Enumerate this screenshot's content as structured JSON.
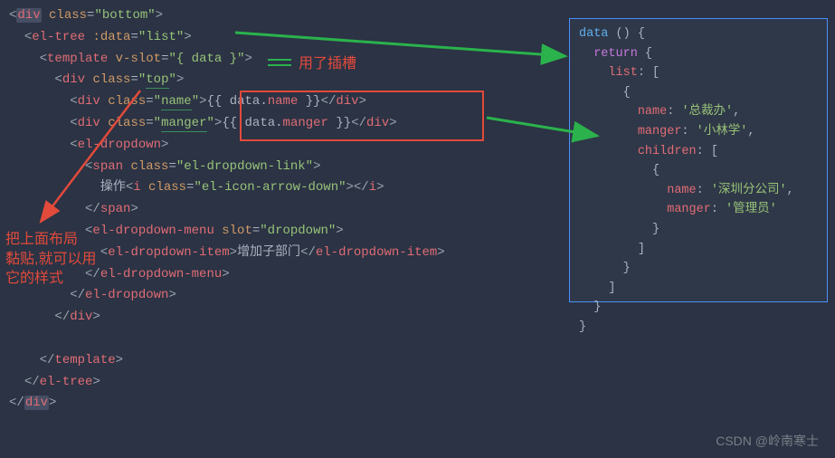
{
  "code": {
    "l1": {
      "tokens": [
        {
          "t": "<",
          "c": "tag-bracket"
        },
        {
          "t": "div",
          "c": "tag-name sel-box"
        },
        {
          "t": " ",
          "c": ""
        },
        {
          "t": "class",
          "c": "attr-name"
        },
        {
          "t": "=",
          "c": "attr-eq"
        },
        {
          "t": "\"bottom\"",
          "c": "attr-val"
        },
        {
          "t": ">",
          "c": "tag-bracket"
        }
      ],
      "indent": 0
    },
    "l2": {
      "tokens": [
        {
          "t": "<",
          "c": "tag-bracket"
        },
        {
          "t": "el-tree",
          "c": "tag-name"
        },
        {
          "t": " ",
          "c": ""
        },
        {
          "t": ":data",
          "c": "attr-name"
        },
        {
          "t": "=",
          "c": "attr-eq"
        },
        {
          "t": "\"list\"",
          "c": "attr-val"
        },
        {
          "t": ">",
          "c": "tag-bracket"
        }
      ],
      "indent": 2
    },
    "l3": {
      "tokens": [
        {
          "t": "<",
          "c": "tag-bracket"
        },
        {
          "t": "template",
          "c": "tag-name"
        },
        {
          "t": " ",
          "c": ""
        },
        {
          "t": "v-slot",
          "c": "attr-name"
        },
        {
          "t": "=",
          "c": "attr-eq"
        },
        {
          "t": "\"{ data }\"",
          "c": "attr-val"
        },
        {
          "t": ">",
          "c": "tag-bracket"
        }
      ],
      "indent": 4
    },
    "l4": {
      "tokens": [
        {
          "t": "<",
          "c": "tag-bracket"
        },
        {
          "t": "div",
          "c": "tag-name"
        },
        {
          "t": " ",
          "c": ""
        },
        {
          "t": "class",
          "c": "attr-name"
        },
        {
          "t": "=",
          "c": "attr-eq"
        },
        {
          "t": "\"",
          "c": "attr-val"
        },
        {
          "t": "top",
          "c": "attr-val underline"
        },
        {
          "t": "\"",
          "c": "attr-val"
        },
        {
          "t": ">",
          "c": "tag-bracket"
        }
      ],
      "indent": 6
    },
    "l5": {
      "tokens": [
        {
          "t": "<",
          "c": "tag-bracket"
        },
        {
          "t": "div",
          "c": "tag-name"
        },
        {
          "t": " ",
          "c": ""
        },
        {
          "t": "class",
          "c": "attr-name"
        },
        {
          "t": "=",
          "c": "attr-eq"
        },
        {
          "t": "\"",
          "c": "attr-val"
        },
        {
          "t": "name",
          "c": "attr-val underline"
        },
        {
          "t": "\"",
          "c": "attr-val"
        },
        {
          "t": ">",
          "c": "tag-bracket"
        },
        {
          "t": "{{ ",
          "c": "mustache"
        },
        {
          "t": "data",
          "c": "text-content"
        },
        {
          "t": ".",
          "c": "text-content"
        },
        {
          "t": "name",
          "c": "mustache-prop"
        },
        {
          "t": " }}",
          "c": "mustache"
        },
        {
          "t": "</",
          "c": "tag-bracket"
        },
        {
          "t": "div",
          "c": "tag-name"
        },
        {
          "t": ">",
          "c": "tag-bracket"
        }
      ],
      "indent": 8
    },
    "l6": {
      "tokens": [
        {
          "t": "<",
          "c": "tag-bracket"
        },
        {
          "t": "div",
          "c": "tag-name"
        },
        {
          "t": " ",
          "c": ""
        },
        {
          "t": "class",
          "c": "attr-name"
        },
        {
          "t": "=",
          "c": "attr-eq"
        },
        {
          "t": "\"",
          "c": "attr-val"
        },
        {
          "t": "manger",
          "c": "attr-val underline"
        },
        {
          "t": "\"",
          "c": "attr-val"
        },
        {
          "t": ">",
          "c": "tag-bracket"
        },
        {
          "t": "{{ ",
          "c": "mustache"
        },
        {
          "t": "data",
          "c": "text-content"
        },
        {
          "t": ".",
          "c": "text-content"
        },
        {
          "t": "manger",
          "c": "mustache-prop"
        },
        {
          "t": " }}",
          "c": "mustache"
        },
        {
          "t": "</",
          "c": "tag-bracket"
        },
        {
          "t": "div",
          "c": "tag-name"
        },
        {
          "t": ">",
          "c": "tag-bracket"
        }
      ],
      "indent": 8
    },
    "l7": {
      "tokens": [
        {
          "t": "<",
          "c": "tag-bracket"
        },
        {
          "t": "el-dropdown",
          "c": "tag-name"
        },
        {
          "t": ">",
          "c": "tag-bracket"
        }
      ],
      "indent": 8
    },
    "l8": {
      "tokens": [
        {
          "t": "<",
          "c": "tag-bracket"
        },
        {
          "t": "span",
          "c": "tag-name"
        },
        {
          "t": " ",
          "c": ""
        },
        {
          "t": "class",
          "c": "attr-name"
        },
        {
          "t": "=",
          "c": "attr-eq"
        },
        {
          "t": "\"el-dropdown-link\"",
          "c": "attr-val"
        },
        {
          "t": ">",
          "c": "tag-bracket"
        }
      ],
      "indent": 10
    },
    "l9": {
      "tokens": [
        {
          "t": "操作",
          "c": "text-content"
        },
        {
          "t": "<",
          "c": "tag-bracket"
        },
        {
          "t": "i",
          "c": "tag-name"
        },
        {
          "t": " ",
          "c": ""
        },
        {
          "t": "class",
          "c": "attr-name"
        },
        {
          "t": "=",
          "c": "attr-eq"
        },
        {
          "t": "\"el-icon-arrow-down\"",
          "c": "attr-val"
        },
        {
          "t": ">",
          "c": "tag-bracket"
        },
        {
          "t": "</",
          "c": "tag-bracket"
        },
        {
          "t": "i",
          "c": "tag-name"
        },
        {
          "t": ">",
          "c": "tag-bracket"
        }
      ],
      "indent": 12
    },
    "l10": {
      "tokens": [
        {
          "t": "</",
          "c": "tag-bracket"
        },
        {
          "t": "span",
          "c": "tag-name"
        },
        {
          "t": ">",
          "c": "tag-bracket"
        }
      ],
      "indent": 10
    },
    "l11": {
      "tokens": [
        {
          "t": "<",
          "c": "tag-bracket"
        },
        {
          "t": "el-dropdown-menu",
          "c": "tag-name"
        },
        {
          "t": " ",
          "c": ""
        },
        {
          "t": "slot",
          "c": "attr-name"
        },
        {
          "t": "=",
          "c": "attr-eq"
        },
        {
          "t": "\"dropdown\"",
          "c": "attr-val"
        },
        {
          "t": ">",
          "c": "tag-bracket"
        }
      ],
      "indent": 10
    },
    "l12": {
      "tokens": [
        {
          "t": "<",
          "c": "tag-bracket"
        },
        {
          "t": "el-dropdown-item",
          "c": "tag-name"
        },
        {
          "t": ">",
          "c": "tag-bracket"
        },
        {
          "t": "增加子部门",
          "c": "text-content"
        },
        {
          "t": "</",
          "c": "tag-bracket"
        },
        {
          "t": "el-dropdown-item",
          "c": "tag-name"
        },
        {
          "t": ">",
          "c": "tag-bracket"
        }
      ],
      "indent": 12
    },
    "l13": {
      "tokens": [
        {
          "t": "</",
          "c": "tag-bracket"
        },
        {
          "t": "el-dropdown-menu",
          "c": "tag-name"
        },
        {
          "t": ">",
          "c": "tag-bracket"
        }
      ],
      "indent": 10
    },
    "l14": {
      "tokens": [
        {
          "t": "</",
          "c": "tag-bracket"
        },
        {
          "t": "el-dropdown",
          "c": "tag-name"
        },
        {
          "t": ">",
          "c": "tag-bracket"
        }
      ],
      "indent": 8
    },
    "l15": {
      "tokens": [
        {
          "t": "</",
          "c": "tag-bracket"
        },
        {
          "t": "div",
          "c": "tag-name"
        },
        {
          "t": ">",
          "c": "tag-bracket"
        }
      ],
      "indent": 6
    },
    "l16": {
      "tokens": [],
      "indent": 0
    },
    "l17": {
      "tokens": [
        {
          "t": "</",
          "c": "tag-bracket"
        },
        {
          "t": "template",
          "c": "tag-name"
        },
        {
          "t": ">",
          "c": "tag-bracket"
        }
      ],
      "indent": 4
    },
    "l18": {
      "tokens": [
        {
          "t": "</",
          "c": "tag-bracket"
        },
        {
          "t": "el-tree",
          "c": "tag-name"
        },
        {
          "t": ">",
          "c": "tag-bracket"
        }
      ],
      "indent": 2
    },
    "l19": {
      "tokens": [
        {
          "t": "</",
          "c": "tag-bracket"
        },
        {
          "t": "div",
          "c": "tag-name sel-box"
        },
        {
          "t": ">",
          "c": "tag-bracket"
        }
      ],
      "indent": 0
    }
  },
  "json": {
    "data_fn": "data",
    "return_kw": "return",
    "list_key": "list",
    "items": [
      {
        "name_key": "name",
        "name_val": "'总裁办'",
        "manger_key": "manger",
        "manger_val": "'小林学'",
        "children_key": "children",
        "children": [
          {
            "name_key": "name",
            "name_val": "'深圳分公司'",
            "manger_key": "manger",
            "manger_val": "'管理员'"
          }
        ]
      }
    ]
  },
  "annotations": {
    "slot_note": "用了插槽",
    "paste_note_l1": "把上面布局",
    "paste_note_l2": "黏贴,就可以用",
    "paste_note_l3": "它的样式"
  },
  "watermark": "CSDN @岭南寒士"
}
